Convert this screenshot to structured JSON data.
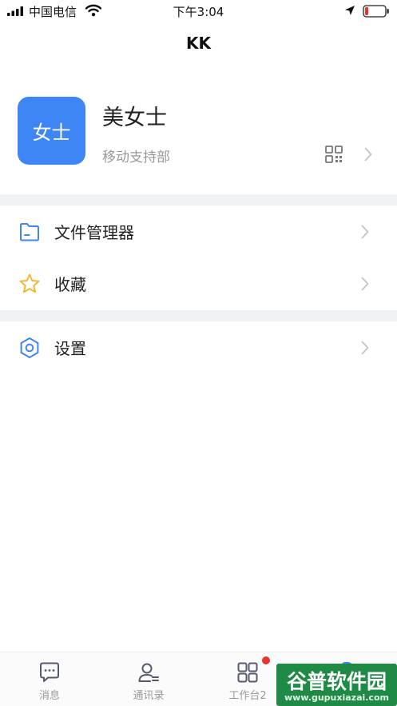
{
  "status_bar": {
    "carrier": "中国电信",
    "time": "下午3:04",
    "battery_color": "#e8342f"
  },
  "nav": {
    "title": "KK"
  },
  "profile": {
    "avatar_text": "女士",
    "name": "美女士",
    "department": "移动支持部",
    "avatar_color": "#3e86f5",
    "qr_icon": "qr-code-icon"
  },
  "menu": {
    "items": [
      {
        "label": "文件管理器",
        "icon": "folder-icon"
      },
      {
        "label": "收藏",
        "icon": "star-icon"
      },
      {
        "label": "设置",
        "icon": "gear-icon"
      }
    ]
  },
  "tabbar": {
    "tabs": [
      {
        "label": "消息",
        "icon": "message-icon"
      },
      {
        "label": "通讯录",
        "icon": "contacts-icon"
      },
      {
        "label": "工作台2",
        "icon": "workbench-icon",
        "badge": true
      },
      {
        "label": "",
        "icon": "me-icon"
      }
    ]
  },
  "watermark": {
    "main": "谷普软件园",
    "sub": "www.gupuxiazai.com"
  },
  "colors": {
    "accent": "#3e86f5",
    "star": "#f2b830",
    "divider": "#f1f2f5"
  }
}
